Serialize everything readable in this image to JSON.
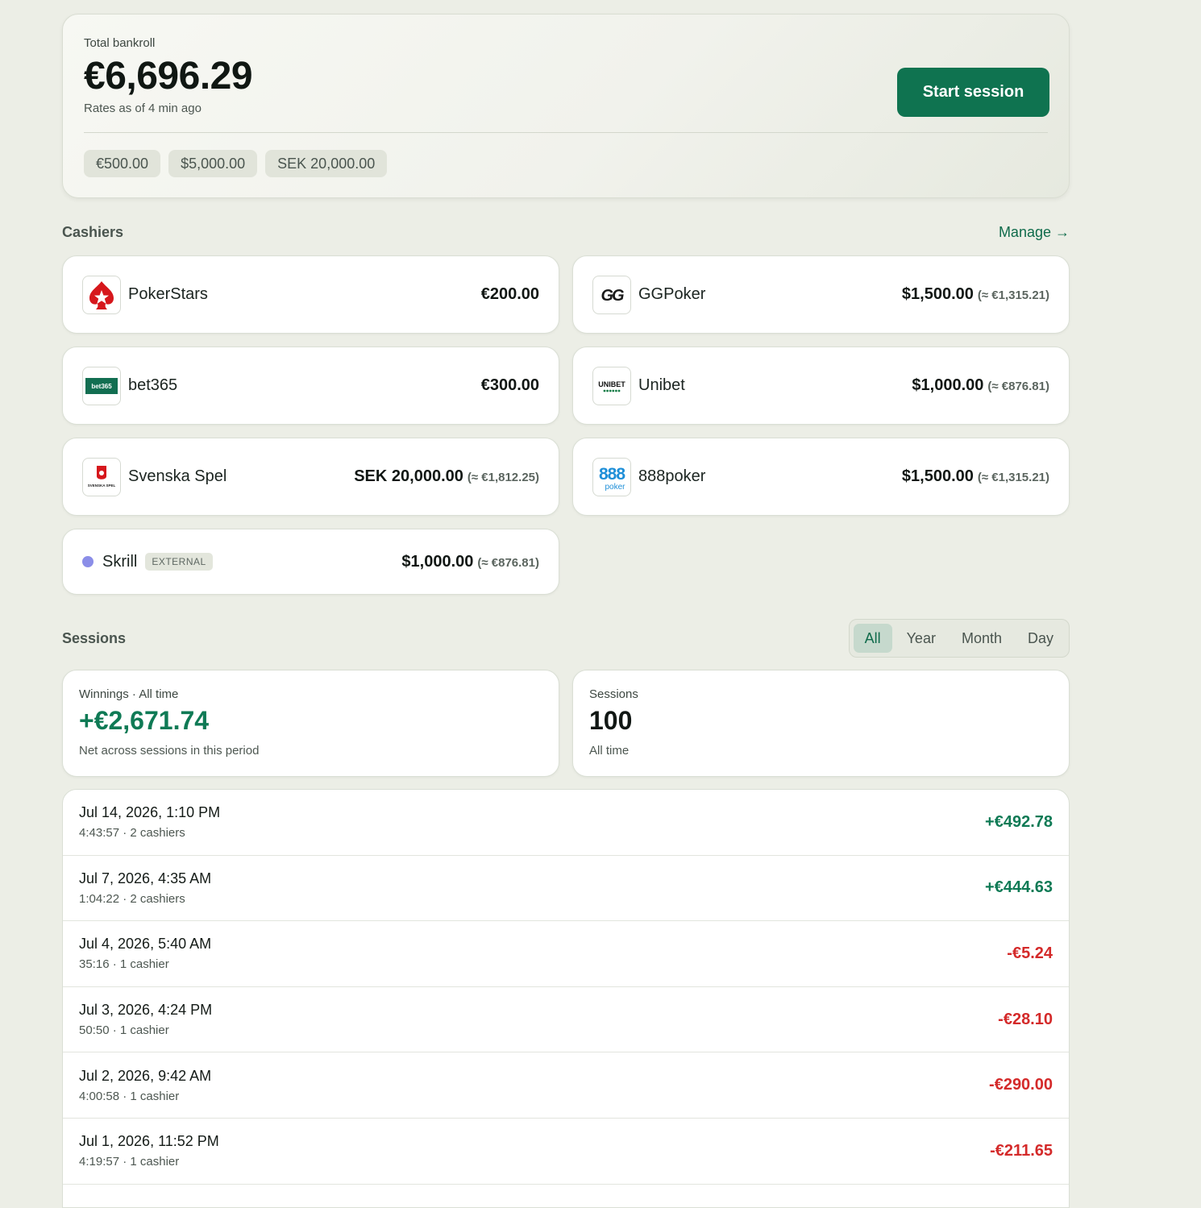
{
  "bankroll": {
    "label": "Total bankroll",
    "total": "€6,696.29",
    "rates_note": "Rates as of 4 min ago",
    "start_button": "Start session",
    "currency_chips": [
      "€500.00",
      "$5,000.00",
      "SEK 20,000.00"
    ]
  },
  "cashiers": {
    "title": "Cashiers",
    "manage_label": "Manage →",
    "items": [
      {
        "name": "PokerStars",
        "balance": "€200.00",
        "converted": "",
        "logo": "pokerstars-logo"
      },
      {
        "name": "GGPoker",
        "balance": "$1,500.00",
        "converted": "(≈ €1,315.21)",
        "logo": "ggpoker-logo"
      },
      {
        "name": "bet365",
        "balance": "€300.00",
        "converted": "",
        "logo": "bet365-logo",
        "logo_text": "bet365"
      },
      {
        "name": "Unibet",
        "balance": "$1,000.00",
        "converted": "(≈ €876.81)",
        "logo": "unibet-logo",
        "logo_text": "UNIBET"
      },
      {
        "name": "Svenska Spel",
        "balance": "SEK 20,000.00",
        "converted": "(≈ €1,812.25)",
        "logo": "svenska-spel-logo",
        "logo_text": "SVENSKA SPEL"
      },
      {
        "name": "888poker",
        "balance": "$1,500.00",
        "converted": "(≈ €1,315.21)",
        "logo": "888poker-logo",
        "logo_text": "888",
        "logo_subtext": "poker"
      },
      {
        "name": "Skrill",
        "badge": "EXTERNAL",
        "balance": "$1,000.00",
        "converted": "(≈ €876.81)",
        "logo": "dot-icon"
      }
    ]
  },
  "sessions": {
    "title": "Sessions",
    "tabs": [
      "All",
      "Year",
      "Month",
      "Day"
    ],
    "active_tab": "All",
    "winnings": {
      "label": "Winnings · All time",
      "value": "+€2,671.74",
      "sub": "Net across sessions in this period"
    },
    "count": {
      "label": "Sessions",
      "value": "100",
      "sub": "All time"
    },
    "rows": [
      {
        "when": "Jul 14, 2026, 1:10 PM",
        "meta": "4:43:57 · 2 cashiers",
        "amount": "+€492.78",
        "sign": "pos"
      },
      {
        "when": "Jul 7, 2026, 4:35 AM",
        "meta": "1:04:22 · 2 cashiers",
        "amount": "+€444.63",
        "sign": "pos"
      },
      {
        "when": "Jul 4, 2026, 5:40 AM",
        "meta": "35:16 · 1 cashier",
        "amount": "-€5.24",
        "sign": "neg"
      },
      {
        "when": "Jul 3, 2026, 4:24 PM",
        "meta": "50:50 · 1 cashier",
        "amount": "-€28.10",
        "sign": "neg"
      },
      {
        "when": "Jul 2, 2026, 9:42 AM",
        "meta": "4:00:58 · 1 cashier",
        "amount": "-€290.00",
        "sign": "neg"
      },
      {
        "when": "Jul 1, 2026, 11:52 PM",
        "meta": "4:19:57 · 1 cashier",
        "amount": "-€211.65",
        "sign": "neg"
      }
    ]
  },
  "colors": {
    "accent": "#0f7350",
    "positive": "#0f7a55",
    "negative": "#d42a2a",
    "background": "#eceee6"
  }
}
